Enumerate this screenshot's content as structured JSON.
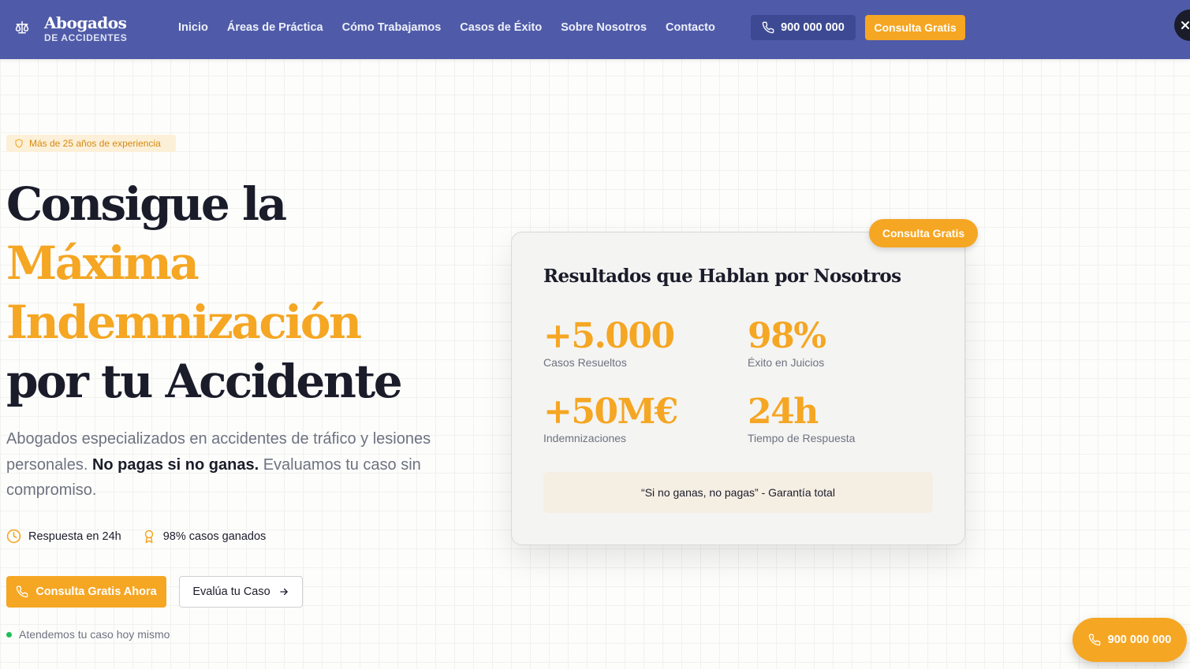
{
  "header": {
    "logo_title": "Abogados",
    "logo_subtitle": "DE ACCIDENTES",
    "nav": [
      "Inicio",
      "Áreas de Práctica",
      "Cómo Trabajamos",
      "Casos de Éxito",
      "Sobre Nosotros",
      "Contacto"
    ],
    "phone": "900 000 000",
    "cta": "Consulta Gratis",
    "close_icon": "x-icon"
  },
  "hero": {
    "badge": "Más de 25 años de experiencia",
    "title_line1": "Consigue la",
    "title_line2": "Máxima",
    "title_line3": "Indemnización",
    "title_line4": "por tu Accidente",
    "desc_part1": "Abogados especializados en accidentes de tráfico y lesiones personales. ",
    "desc_bold": "No pagas si no ganas.",
    "desc_part2": " Evaluamos tu caso sin compromiso.",
    "feature_1": "Respuesta en 24h",
    "feature_2": "98% casos ganados",
    "cta_primary": "Consulta Gratis Ahora",
    "cta_secondary": "Evalúa tu Caso",
    "status": "Atendemos tu caso hoy mismo"
  },
  "card": {
    "badge": "Consulta Gratis",
    "title": "Resultados que Hablan por Nosotros",
    "stats": [
      {
        "value": "+5.000",
        "label": "Casos Resueltos"
      },
      {
        "value": "98%",
        "label": "Éxito en Juicios"
      },
      {
        "value": "+50M€",
        "label": "Indemnizaciones"
      },
      {
        "value": "24h",
        "label": "Tiempo de Respuesta"
      }
    ],
    "guarantee": "“Si no ganas, no pagas” - Garantía total"
  },
  "floating": {
    "phone": "900 000 000"
  },
  "colors": {
    "header": "#4f5ba8",
    "accent": "#f5a623",
    "dark": "#1b1c2a",
    "muted": "#6e7280"
  }
}
